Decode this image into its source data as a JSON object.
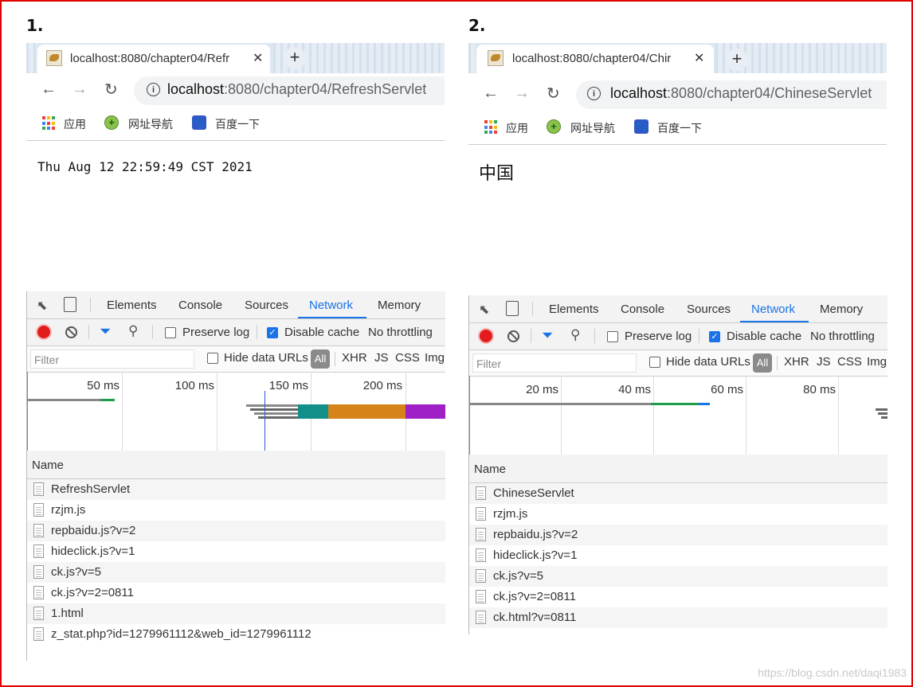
{
  "panels": [
    {
      "number": "1.",
      "tab_title": "localhost:8080/chapter04/Refr",
      "url_host": "localhost",
      "url_path": ":8080/chapter04/RefreshServlet",
      "bookmarks": [
        "应用",
        "网址导航",
        "百度一下"
      ],
      "content_text": "Thu Aug 12 22:59:49 CST 2021",
      "devtools": {
        "tabs": [
          "Elements",
          "Console",
          "Sources",
          "Network",
          "Memory"
        ],
        "active_tab": "Network",
        "preserve_log_label": "Preserve log",
        "disable_cache_label": "Disable cache",
        "throttling_label": "No throttling",
        "filter_placeholder": "Filter",
        "hide_data_urls_label": "Hide data URLs",
        "type_filters": [
          "All",
          "XHR",
          "JS",
          "CSS",
          "Img"
        ],
        "timeline_ticks": [
          "50 ms",
          "100 ms",
          "150 ms",
          "200 ms"
        ],
        "name_header": "Name",
        "requests": [
          "RefreshServlet",
          "rzjm.js",
          "repbaidu.js?v=2",
          "hideclick.js?v=1",
          "ck.js?v=5",
          "ck.js?v=2=0811",
          "1.html",
          "z_stat.php?id=1279961112&web_id=1279961112"
        ]
      }
    },
    {
      "number": "2.",
      "tab_title": "localhost:8080/chapter04/Chir",
      "url_host": "localhost",
      "url_path": ":8080/chapter04/ChineseServlet",
      "bookmarks": [
        "应用",
        "网址导航",
        "百度一下"
      ],
      "content_text": "中国",
      "devtools": {
        "tabs": [
          "Elements",
          "Console",
          "Sources",
          "Network",
          "Memory"
        ],
        "active_tab": "Network",
        "preserve_log_label": "Preserve log",
        "disable_cache_label": "Disable cache",
        "throttling_label": "No throttling",
        "filter_placeholder": "Filter",
        "hide_data_urls_label": "Hide data URLs",
        "type_filters": [
          "All",
          "XHR",
          "JS",
          "CSS",
          "Img"
        ],
        "timeline_ticks": [
          "20 ms",
          "40 ms",
          "60 ms",
          "80 ms"
        ],
        "name_header": "Name",
        "requests": [
          "ChineseServlet",
          "rzjm.js",
          "repbaidu.js?v=2",
          "hideclick.js?v=1",
          "ck.js?v=5",
          "ck.js?v=2=0811",
          "ck.html?v=0811"
        ]
      }
    }
  ],
  "watermark": "https://blog.csdn.net/daqi1983",
  "colors": {
    "frame": "#e00000",
    "accent": "#1a73e8",
    "record": "#e21b1b"
  }
}
